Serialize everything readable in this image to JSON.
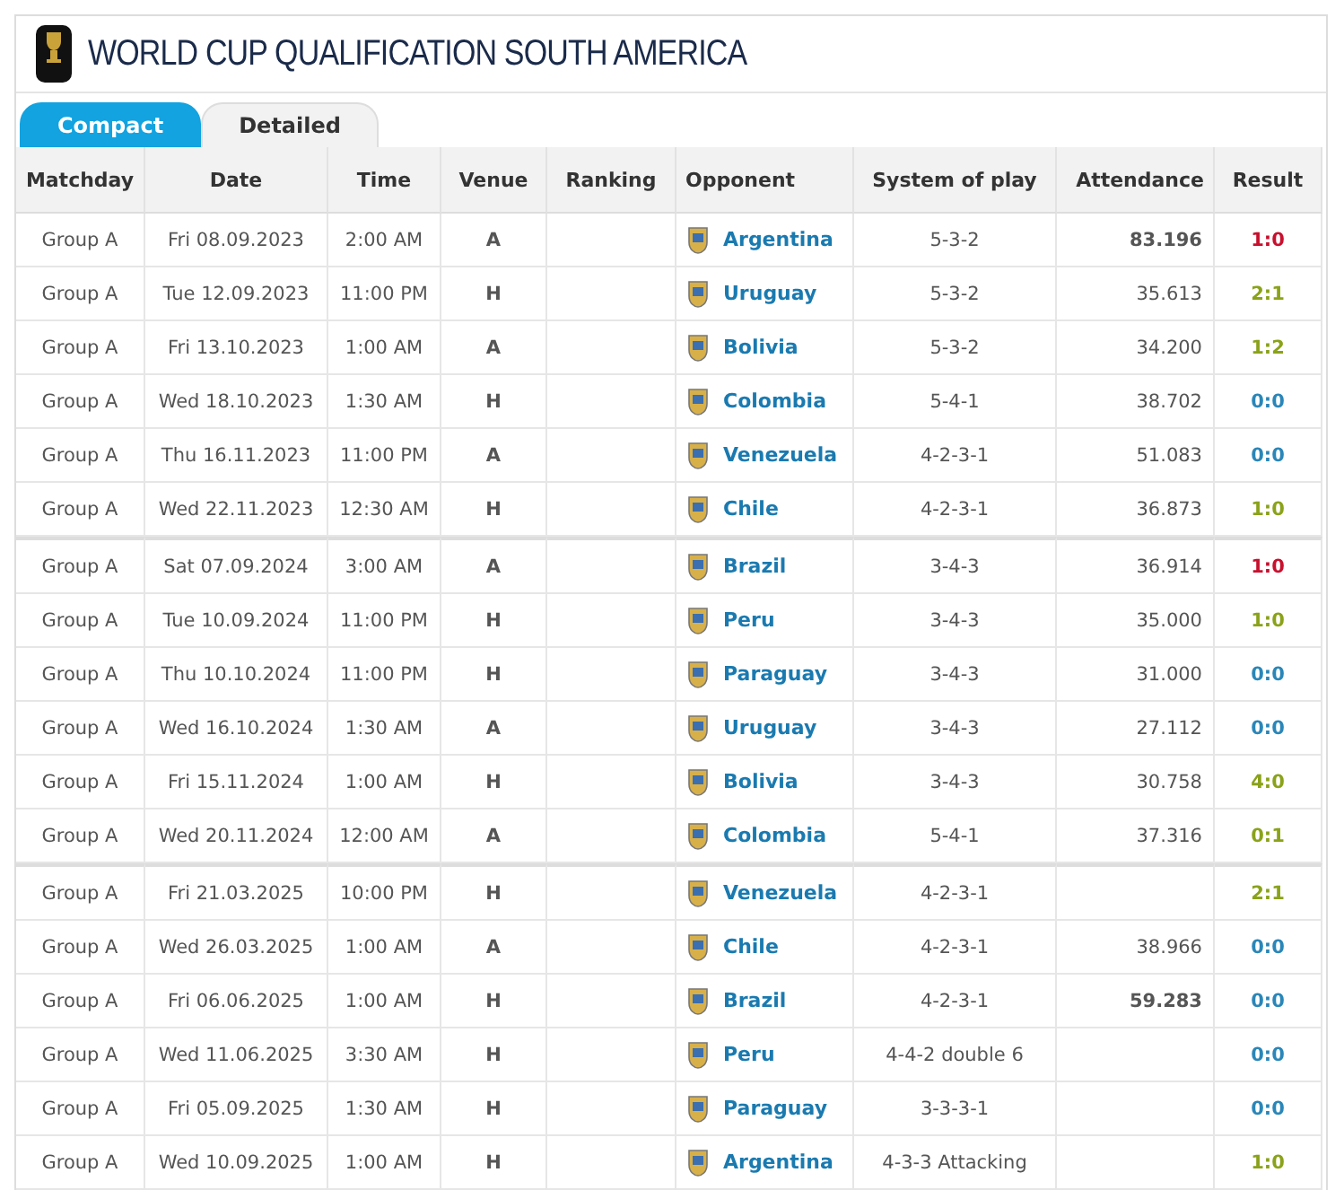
{
  "title": "WORLD CUP QUALIFICATION SOUTH AMERICA",
  "tabs": [
    {
      "label": "Compact",
      "selected": true
    },
    {
      "label": "Detailed",
      "selected": false
    }
  ],
  "columns": [
    "Matchday",
    "Date",
    "Time",
    "Venue",
    "Ranking",
    "Opponent",
    "System of play",
    "Attendance",
    "Result"
  ],
  "sections": [
    {
      "rows": [
        {
          "matchday": "Group A",
          "date": "Fri 08.09.2023",
          "time": "2:00 AM",
          "venue": "A",
          "opponent": "Argentina",
          "system": "5-3-2",
          "attendance": "83.196",
          "bold_attendance": true,
          "result": "1:0",
          "color": "#c8102e"
        },
        {
          "matchday": "Group A",
          "date": "Tue 12.09.2023",
          "time": "11:00 PM",
          "venue": "H",
          "opponent": "Uruguay",
          "system": "5-3-2",
          "attendance": "35.613",
          "bold_attendance": false,
          "result": "2:1",
          "color": "#8aa21a"
        },
        {
          "matchday": "Group A",
          "date": "Fri 13.10.2023",
          "time": "1:00 AM",
          "venue": "A",
          "opponent": "Bolivia",
          "system": "5-3-2",
          "attendance": "34.200",
          "bold_attendance": false,
          "result": "1:2",
          "color": "#8aa21a"
        },
        {
          "matchday": "Group A",
          "date": "Wed 18.10.2023",
          "time": "1:30 AM",
          "venue": "H",
          "opponent": "Colombia",
          "system": "5-4-1",
          "attendance": "38.702",
          "bold_attendance": false,
          "result": "0:0",
          "color": "#2a86b8"
        },
        {
          "matchday": "Group A",
          "date": "Thu 16.11.2023",
          "time": "11:00 PM",
          "venue": "A",
          "opponent": "Venezuela",
          "system": "4-2-3-1",
          "attendance": "51.083",
          "bold_attendance": false,
          "result": "0:0",
          "color": "#2a86b8"
        },
        {
          "matchday": "Group A",
          "date": "Wed 22.11.2023",
          "time": "12:30 AM",
          "venue": "H",
          "opponent": "Chile",
          "system": "4-2-3-1",
          "attendance": "36.873",
          "bold_attendance": false,
          "result": "1:0",
          "color": "#8aa21a"
        }
      ]
    },
    {
      "rows": [
        {
          "matchday": "Group A",
          "date": "Sat 07.09.2024",
          "time": "3:00 AM",
          "venue": "A",
          "opponent": "Brazil",
          "system": "3-4-3",
          "attendance": "36.914",
          "bold_attendance": false,
          "result": "1:0",
          "color": "#c8102e"
        },
        {
          "matchday": "Group A",
          "date": "Tue 10.09.2024",
          "time": "11:00 PM",
          "venue": "H",
          "opponent": "Peru",
          "system": "3-4-3",
          "attendance": "35.000",
          "bold_attendance": false,
          "result": "1:0",
          "color": "#8aa21a"
        },
        {
          "matchday": "Group A",
          "date": "Thu 10.10.2024",
          "time": "11:00 PM",
          "venue": "H",
          "opponent": "Paraguay",
          "system": "3-4-3",
          "attendance": "31.000",
          "bold_attendance": false,
          "result": "0:0",
          "color": "#2a86b8"
        },
        {
          "matchday": "Group A",
          "date": "Wed 16.10.2024",
          "time": "1:30 AM",
          "venue": "A",
          "opponent": "Uruguay",
          "system": "3-4-3",
          "attendance": "27.112",
          "bold_attendance": false,
          "result": "0:0",
          "color": "#2a86b8"
        },
        {
          "matchday": "Group A",
          "date": "Fri 15.11.2024",
          "time": "1:00 AM",
          "venue": "H",
          "opponent": "Bolivia",
          "system": "3-4-3",
          "attendance": "30.758",
          "bold_attendance": false,
          "result": "4:0",
          "color": "#8aa21a"
        },
        {
          "matchday": "Group A",
          "date": "Wed 20.11.2024",
          "time": "12:00 AM",
          "venue": "A",
          "opponent": "Colombia",
          "system": "5-4-1",
          "attendance": "37.316",
          "bold_attendance": false,
          "result": "0:1",
          "color": "#8aa21a"
        }
      ]
    },
    {
      "rows": [
        {
          "matchday": "Group A",
          "date": "Fri 21.03.2025",
          "time": "10:00 PM",
          "venue": "H",
          "opponent": "Venezuela",
          "system": "4-2-3-1",
          "result": "2:1",
          "color": "#8aa21a"
        },
        {
          "matchday": "Group A",
          "date": "Wed 26.03.2025",
          "time": "1:00 AM",
          "venue": "A",
          "opponent": "Chile",
          "system": "4-2-3-1",
          "attendance": "38.966",
          "bold_attendance": false,
          "result": "0:0",
          "color": "#2a86b8"
        },
        {
          "matchday": "Group A",
          "date": "Fri 06.06.2025",
          "time": "1:00 AM",
          "venue": "H",
          "opponent": "Brazil",
          "system": "4-2-3-1",
          "attendance": "59.283",
          "bold_attendance": true,
          "result": "0:0",
          "color": "#2a86b8"
        },
        {
          "matchday": "Group A",
          "date": "Wed 11.06.2025",
          "time": "3:30 AM",
          "venue": "H",
          "opponent": "Peru",
          "system": "4-4-2 double 6",
          "result": "0:0",
          "color": "#2a86b8"
        },
        {
          "matchday": "Group A",
          "date": "Fri 05.09.2025",
          "time": "1:30 AM",
          "venue": "H",
          "opponent": "Paraguay",
          "system": "3-3-3-1",
          "result": "0:0",
          "color": "#2a86b8"
        },
        {
          "matchday": "Group A",
          "date": "Wed 10.09.2025",
          "time": "1:00 AM",
          "venue": "H",
          "opponent": "Argentina",
          "system": "4-3-3 Attacking",
          "result": "1:0",
          "color": "#8aa21a"
        }
      ]
    }
  ]
}
